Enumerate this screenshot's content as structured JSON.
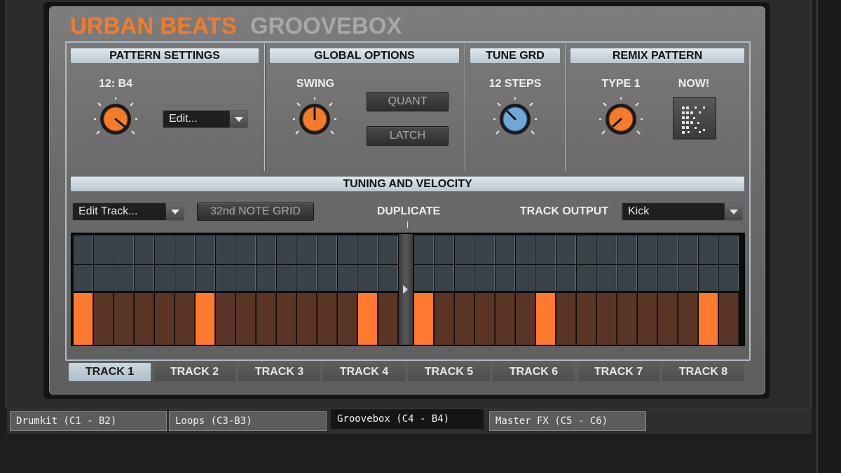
{
  "app": {
    "title_main": "URBAN BEATS",
    "title_sub": "GROOVEBOX"
  },
  "colors": {
    "accent": "#f47b2a",
    "knob_blue": "#6ea7d8",
    "step_on": "#ff7a2e",
    "step_off": "#5a3526",
    "grid_cell": "#3a424a"
  },
  "pattern_settings": {
    "header": "PATTERN SETTINGS",
    "knob_label": "12: B4",
    "dropdown_value": "Edit..."
  },
  "global_options": {
    "header": "GLOBAL OPTIONS",
    "swing_label": "SWING",
    "quant_label": "QUANT",
    "latch_label": "LATCH"
  },
  "tune_grid": {
    "header": "TUNE GRD",
    "knob_label": "12 STEPS"
  },
  "remix_pattern": {
    "header": "REMIX PATTERN",
    "type_label": "TYPE 1",
    "now_label": "NOW!"
  },
  "tuning": {
    "header": "TUNING AND VELOCITY",
    "edit_track_value": "Edit Track...",
    "note_grid_label": "32nd NOTE GRID",
    "duplicate_label": "DUPLICATE",
    "track_output_label": "TRACK OUTPUT",
    "track_output_value": "Kick"
  },
  "sequencer": {
    "steps": 32,
    "active_steps": [
      1,
      7,
      15,
      17,
      23,
      31
    ]
  },
  "tracks": [
    "TRACK 1",
    "TRACK 2",
    "TRACK 3",
    "TRACK 4",
    "TRACK 5",
    "TRACK 6",
    "TRACK 7",
    "TRACK 8"
  ],
  "active_track": 0,
  "bottom_tabs": [
    "Drumkit (C1 - B2)",
    "Loops (C3-B3)",
    "Groovebox (C4 - B4)",
    "Master FX (C5 - C6)"
  ],
  "active_bottom_tab": 2
}
